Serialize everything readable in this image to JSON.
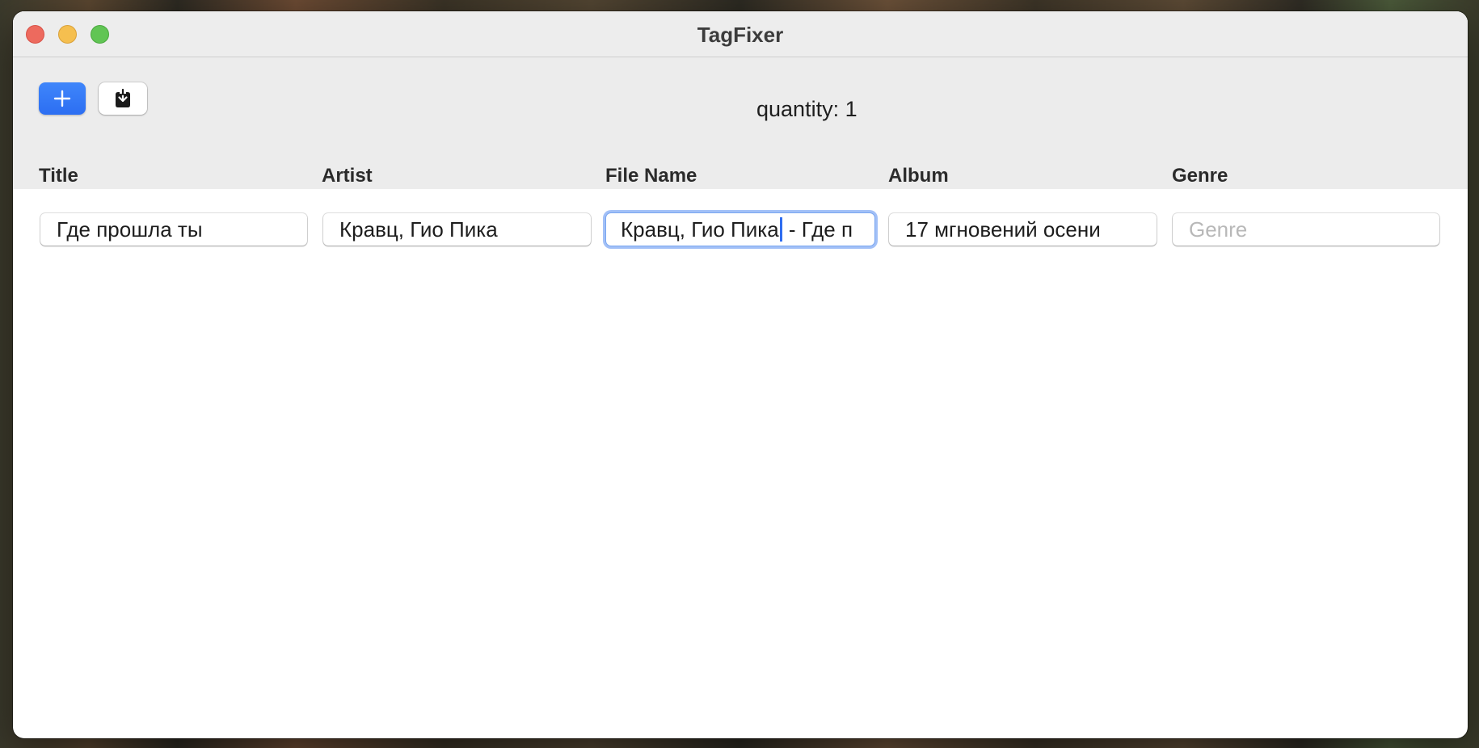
{
  "window": {
    "title": "TagFixer"
  },
  "toolbar": {
    "add_icon": "plus-icon",
    "save_icon": "download-icon",
    "quantity_label": "quantity: 1"
  },
  "columns": {
    "title": "Title",
    "artist": "Artist",
    "file_name": "File Name",
    "album": "Album",
    "genre": "Genre"
  },
  "row": {
    "title": "Где прошла ты",
    "artist": "Кравц, Гио Пика",
    "file_name_before_caret": "Кравц, Гио Пика",
    "file_name_after_caret": " - Где п",
    "album": "17 мгновений осени",
    "genre": "",
    "genre_placeholder": "Genre"
  },
  "colors": {
    "accent": "#2c6ef2",
    "focus_ring": "#558cf0"
  }
}
